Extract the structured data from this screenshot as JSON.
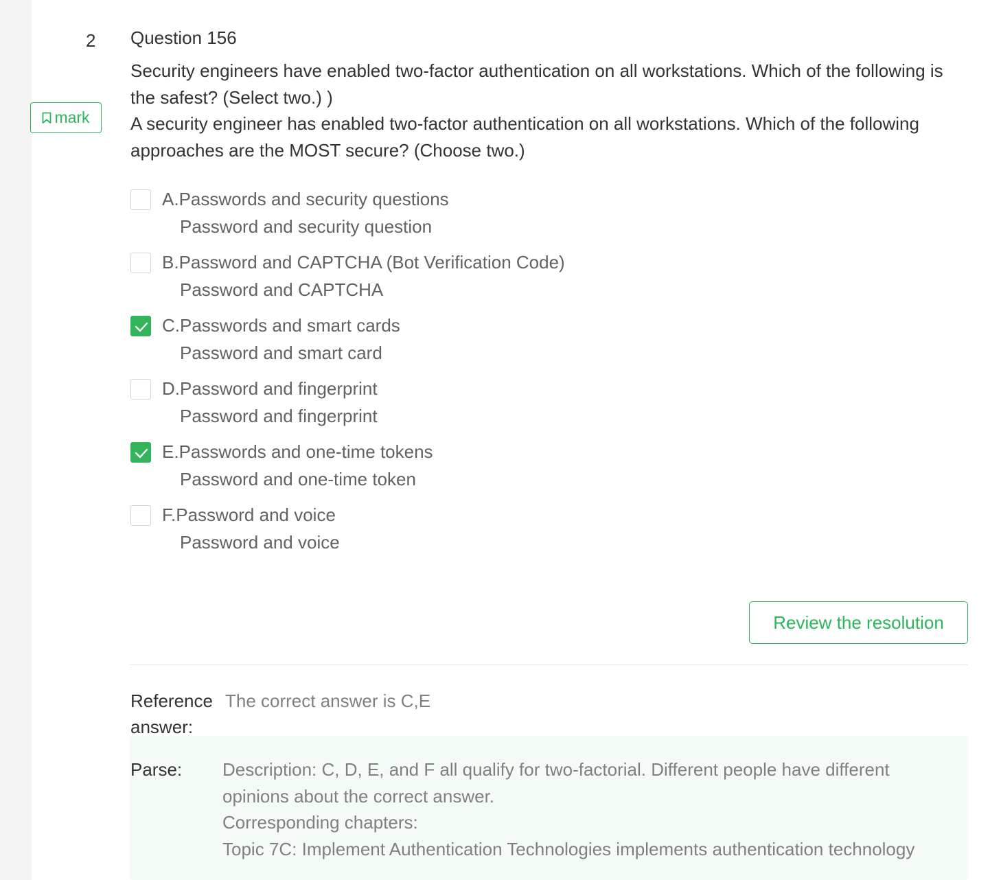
{
  "question": {
    "index": "2",
    "title": "Question 156",
    "stem_line1": "Security engineers have enabled two-factor authentication on all workstations. Which of the following is the safest? (Select two.) )",
    "stem_line2": "A security engineer has enabled two-factor authentication on all workstations. Which of the following approaches are the MOST secure? (Choose two.)"
  },
  "mark_button": {
    "label": "mark",
    "icon": "bookmark-icon"
  },
  "options": [
    {
      "letter": "A.",
      "text": "Passwords and security questions",
      "subtext": "Password and security question",
      "checked": false
    },
    {
      "letter": "B.",
      "text": "Password and CAPTCHA (Bot Verification Code)",
      "subtext": "Password and CAPTCHA",
      "checked": false
    },
    {
      "letter": "C.",
      "text": "Passwords and smart cards",
      "subtext": "Password and smart card",
      "checked": true
    },
    {
      "letter": "D.",
      "text": "Password and fingerprint",
      "subtext": "Password and fingerprint",
      "checked": false
    },
    {
      "letter": "E.",
      "text": "Passwords and one-time tokens",
      "subtext": "Password and one-time token",
      "checked": true
    },
    {
      "letter": "F.",
      "text": "Password and voice",
      "subtext": "Password and voice",
      "checked": false
    }
  ],
  "review_button": {
    "label": "Review the resolution"
  },
  "reference": {
    "label": "Reference answer:",
    "value": "The correct answer is C,E"
  },
  "parse": {
    "label": "Parse:",
    "lines": [
      "Description: C, D, E, and F all qualify for two-factorial. Different people have different opinions about the correct answer.",
      "Corresponding chapters:",
      "Topic 7C: Implement Authentication Technologies implements authentication technology"
    ]
  },
  "colors": {
    "accent": "#2db55d",
    "checkbox_checked": "#33b45b",
    "parse_background": "#f4faf6",
    "left_rail": "#f3f3f3"
  }
}
